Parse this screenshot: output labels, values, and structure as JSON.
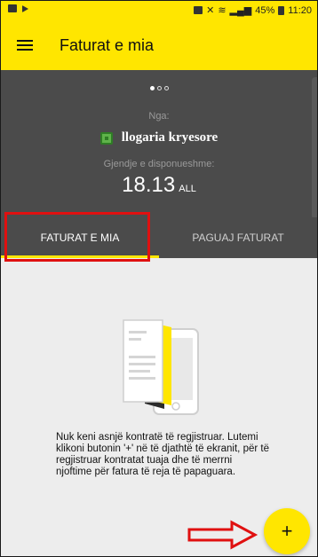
{
  "status_bar": {
    "battery": "45%",
    "time": "11:20"
  },
  "app_bar": {
    "title": "Faturat e mia",
    "menu_icon": "hamburger-menu-icon"
  },
  "account_card": {
    "from_label": "Nga:",
    "account_name": "llogaria kryesore",
    "available_label": "Gjendje e disponueshme:",
    "balance": "18.13",
    "currency": "ALL",
    "pager_dots": 3,
    "active_dot": 1
  },
  "tabs": [
    {
      "label": "FATURAT E MIA",
      "active": true
    },
    {
      "label": "PAGUAJ FATURAT",
      "active": false
    }
  ],
  "empty_state": {
    "message": "Nuk keni asnjë kontratë të regjistruar. Lutemi klikoni butonin '+' në të djathtë të ekranit, për të regjistruar kontratat tuaja dhe të merrni njoftime për fatura të reja të papaguara."
  },
  "fab": {
    "label": "+"
  },
  "colors": {
    "accent": "#ffe600",
    "header_dark": "#4b4b4b",
    "background": "#ededed",
    "annotation_red": "#e01010"
  }
}
